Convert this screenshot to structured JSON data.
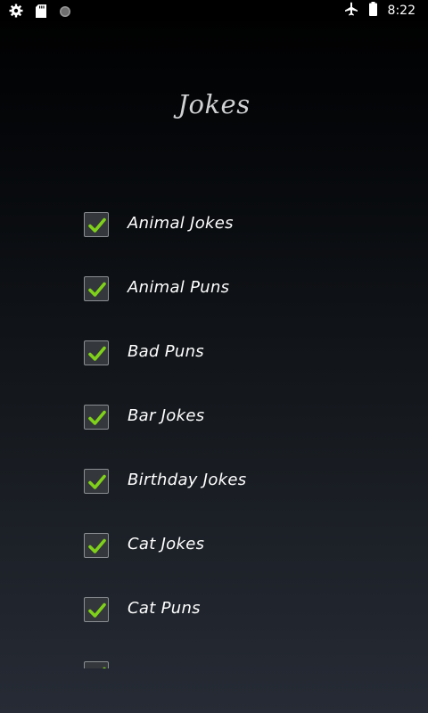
{
  "status_bar": {
    "time": "8:22",
    "icons": [
      "settings-icon",
      "sd-card-icon",
      "circle-icon",
      "airplane-mode-icon",
      "battery-icon"
    ]
  },
  "screen_title": "Jokes",
  "categories": [
    {
      "label": "Animal Jokes",
      "checked": true
    },
    {
      "label": "Animal Puns",
      "checked": true
    },
    {
      "label": "Bad Puns",
      "checked": true
    },
    {
      "label": "Bar Jokes",
      "checked": true
    },
    {
      "label": "Birthday Jokes",
      "checked": true
    },
    {
      "label": "Cat Jokes",
      "checked": true
    },
    {
      "label": "Cat Puns",
      "checked": true
    },
    {
      "label": "",
      "checked": true
    }
  ],
  "colors": {
    "check_mark": "#7fd11a"
  }
}
